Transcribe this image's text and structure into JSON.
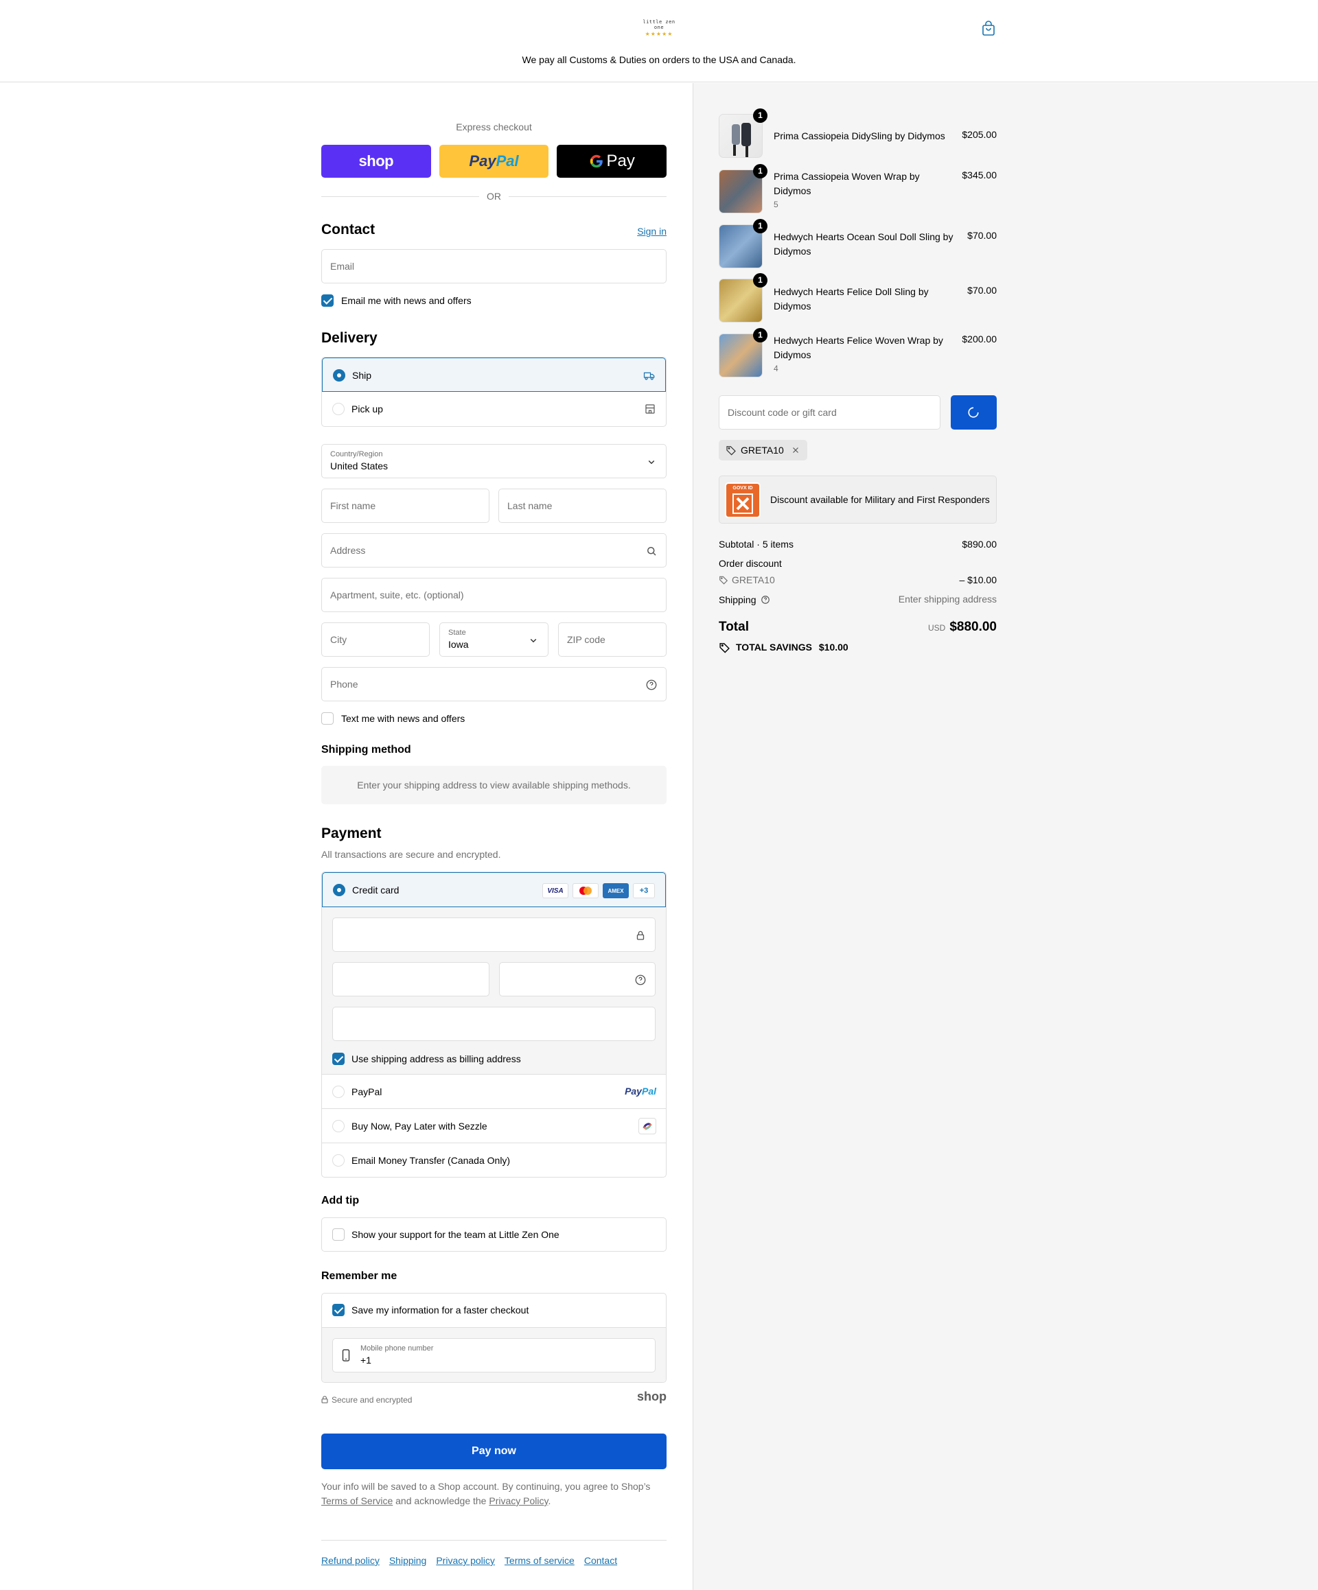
{
  "header": {
    "logo_text": "little zen one",
    "logo_stars": "★★★★★",
    "announcement": "We pay all Customs & Duties on orders to the USA and Canada."
  },
  "express": {
    "title": "Express checkout",
    "shop_label": "shop",
    "paypal_label_1": "Pay",
    "paypal_label_2": "Pal",
    "gpay_label": "Pay",
    "or": "OR"
  },
  "contact": {
    "title": "Contact",
    "sign_in": "Sign in",
    "email_placeholder": "Email",
    "news_label": "Email me with news and offers"
  },
  "delivery": {
    "title": "Delivery",
    "options": [
      {
        "label": "Ship",
        "selected": true
      },
      {
        "label": "Pick up",
        "selected": false
      }
    ],
    "country_label": "Country/Region",
    "country_value": "United States",
    "first_name": "First name",
    "last_name": "Last name",
    "address": "Address",
    "apartment": "Apartment, suite, etc. (optional)",
    "city": "City",
    "state_label": "State",
    "state_value": "Iowa",
    "zip": "ZIP code",
    "phone": "Phone",
    "text_label": "Text me with news and offers"
  },
  "shipping_method": {
    "title": "Shipping method",
    "message": "Enter your shipping address to view available shipping methods."
  },
  "payment": {
    "title": "Payment",
    "subtitle": "All transactions are secure and encrypted.",
    "credit_card": "Credit card",
    "visa": "VISA",
    "amex": "AMEX",
    "more_cards": "+3",
    "billing_label": "Use shipping address as billing address",
    "paypal": "PayPal",
    "paypal_logo_1": "Pay",
    "paypal_logo_2": "Pal",
    "sezzle": "Buy Now, Pay Later with Sezzle",
    "emt": "Email Money Transfer (Canada Only)"
  },
  "tip": {
    "title": "Add tip",
    "label": "Show your support for the team at Little Zen One"
  },
  "remember": {
    "title": "Remember me",
    "save_label": "Save my information for a faster checkout",
    "mobile_label": "Mobile phone number",
    "mobile_value": "+1",
    "secure": "Secure and encrypted",
    "shop_logo": "shop"
  },
  "pay_now": "Pay now",
  "legal": {
    "text1": "Your info will be saved to a Shop account. By continuing, you agree to Shop’s",
    "tos": "Terms of Service",
    "text2": " and acknowledge the ",
    "privacy": "Privacy Policy",
    "text3": "."
  },
  "footer": [
    "Refund policy",
    "Shipping",
    "Privacy policy",
    "Terms of service",
    "Contact"
  ],
  "cart": {
    "items": [
      {
        "name": "Prima Cassiopeia DidySling by Didymos",
        "variant": "",
        "qty": "1",
        "price": "$205.00"
      },
      {
        "name": "Prima Cassiopeia Woven Wrap by Didymos",
        "variant": "5",
        "qty": "1",
        "price": "$345.00"
      },
      {
        "name": "Hedwych Hearts Ocean Soul Doll Sling by Didymos",
        "variant": "",
        "qty": "1",
        "price": "$70.00"
      },
      {
        "name": "Hedwych Hearts Felice Doll Sling by Didymos",
        "variant": "",
        "qty": "1",
        "price": "$70.00"
      },
      {
        "name": "Hedwych Hearts Felice Woven Wrap by Didymos",
        "variant": "4",
        "qty": "1",
        "price": "$200.00"
      }
    ],
    "discount_placeholder": "Discount code or gift card",
    "applied_code": "GRETA10",
    "military": "Discount available for Military and First Responders",
    "military_logo": "GOVX ID",
    "subtotal_label": "Subtotal · 5 items",
    "subtotal": "$890.00",
    "order_discount": "Order discount",
    "discount_code": "GRETA10",
    "discount_amount": "– $10.00",
    "shipping_label": "Shipping",
    "shipping_value": "Enter shipping address",
    "total_label": "Total",
    "currency": "USD",
    "total": "$880.00",
    "savings_label": "TOTAL SAVINGS",
    "savings": "$10.00"
  },
  "colors": {
    "accent": "#1773b0",
    "pay_button": "#0b57d0",
    "shop": "#5a31f4",
    "paypal": "#ffc439"
  }
}
